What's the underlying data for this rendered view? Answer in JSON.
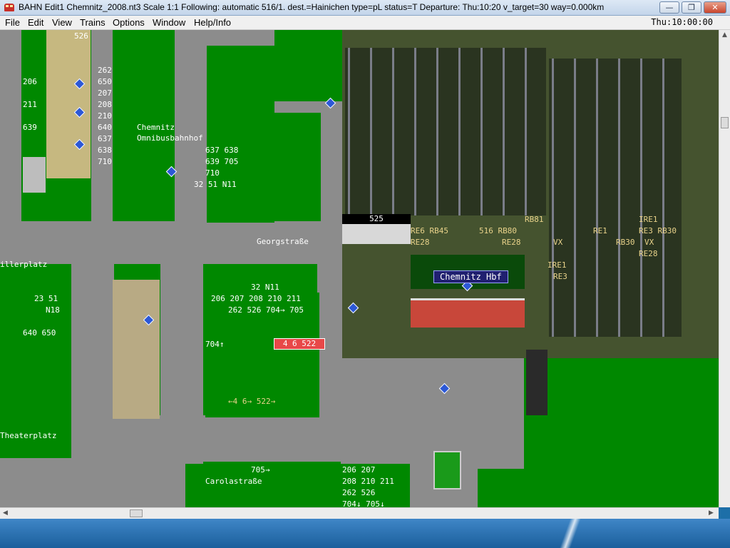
{
  "window": {
    "title": "BAHN Edit1 Chemnitz_2008.nt3 Scale 1:1 Following: automatic 516/1.  dest.=Hainichen type=pL status=T  Departure: Thu:10:20 v_target=30 way=0.000km",
    "controls": {
      "minimize": "—",
      "maximize": "❐",
      "close": "✕"
    }
  },
  "menu": {
    "items": [
      "File",
      "Edit",
      "View",
      "Trains",
      "Options",
      "Window",
      "Help/Info"
    ],
    "clock": "Thu:10:00:00"
  },
  "map": {
    "places": {
      "omnibus1": "Chemnitz",
      "omnibus2": "Omnibusbahnhof",
      "georg": "Georgstraße",
      "miller": "illerplatz",
      "theater": "Theaterplatz",
      "carola": "Carolastraße",
      "hbf": "Chemnitz Hbf"
    },
    "labels": {
      "l526": "526",
      "l262": "262",
      "l650": "650",
      "l207": "207",
      "l208": "208",
      "l210": "210",
      "l640": "640",
      "l637": "637",
      "l638": "638",
      "l710": "710",
      "l206": "206",
      "l211": "211",
      "l639": "639",
      "ob1": "637 638",
      "ob2": "639 705",
      "ob3": "710",
      "ob4": "32 51 N11",
      "mid1": "32 N11",
      "mid2": "206 207 208 210 211",
      "mid3": "262 526 704→ 705",
      "left1": "23 51",
      "left2": "N18",
      "left3": "640 650",
      "l704": "704↑",
      "arrows": "←4 6→ 522→",
      "l705b": "705→",
      "bot1": "206 207",
      "bot2": "208 210 211",
      "bot3": "262 526",
      "bot4": "704↓ 705↓",
      "s525": "525",
      "re6": "RE6 RB45",
      "re28": "RE28",
      "l516": "516 RB80",
      "re28b": "RE28",
      "rb81": "RB81",
      "vx": "VX",
      "ire1": "IRE1",
      "re3": "RE3",
      "re1": "RE1",
      "rb30": "RB30",
      "vx2": "VX",
      "re28c": "RE28",
      "ire1b": "IRE1",
      "re3b": "RE3 RB30"
    },
    "train_sign": "4 6 522"
  }
}
